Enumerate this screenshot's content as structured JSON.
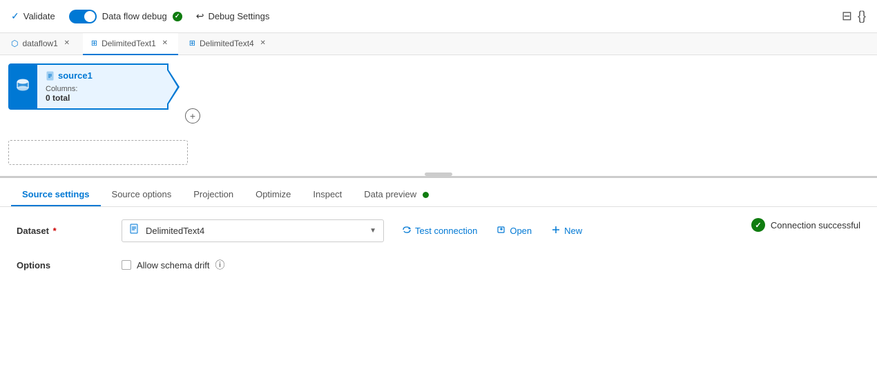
{
  "toolbar": {
    "validate_label": "Validate",
    "debug_label": "Data flow debug",
    "debug_settings_label": "Debug Settings"
  },
  "tabs": [
    {
      "id": "dataflow1",
      "label": "dataflow1",
      "icon": "⬡"
    },
    {
      "id": "DelimitedText1",
      "label": "DelimitedText1",
      "icon": "⊞"
    },
    {
      "id": "DelimitedText4",
      "label": "DelimitedText4",
      "icon": "⊞"
    }
  ],
  "node": {
    "title": "source1",
    "subtitle": "Columns:",
    "count": "0 total",
    "icon": "🗄"
  },
  "panel": {
    "tabs": [
      {
        "id": "source-settings",
        "label": "Source settings",
        "active": true
      },
      {
        "id": "source-options",
        "label": "Source options",
        "active": false
      },
      {
        "id": "projection",
        "label": "Projection",
        "active": false
      },
      {
        "id": "optimize",
        "label": "Optimize",
        "active": false
      },
      {
        "id": "inspect",
        "label": "Inspect",
        "active": false
      },
      {
        "id": "data-preview",
        "label": "Data preview",
        "active": false,
        "dot": true
      }
    ]
  },
  "connection": {
    "status": "Connection successful"
  },
  "dataset": {
    "label": "Dataset",
    "required": true,
    "value": "DelimitedText4"
  },
  "options": {
    "label": "Options",
    "schema_drift_label": "Allow schema drift",
    "schema_drift_info": true
  },
  "actions": {
    "test_connection": "Test connection",
    "open": "Open",
    "new": "New"
  }
}
